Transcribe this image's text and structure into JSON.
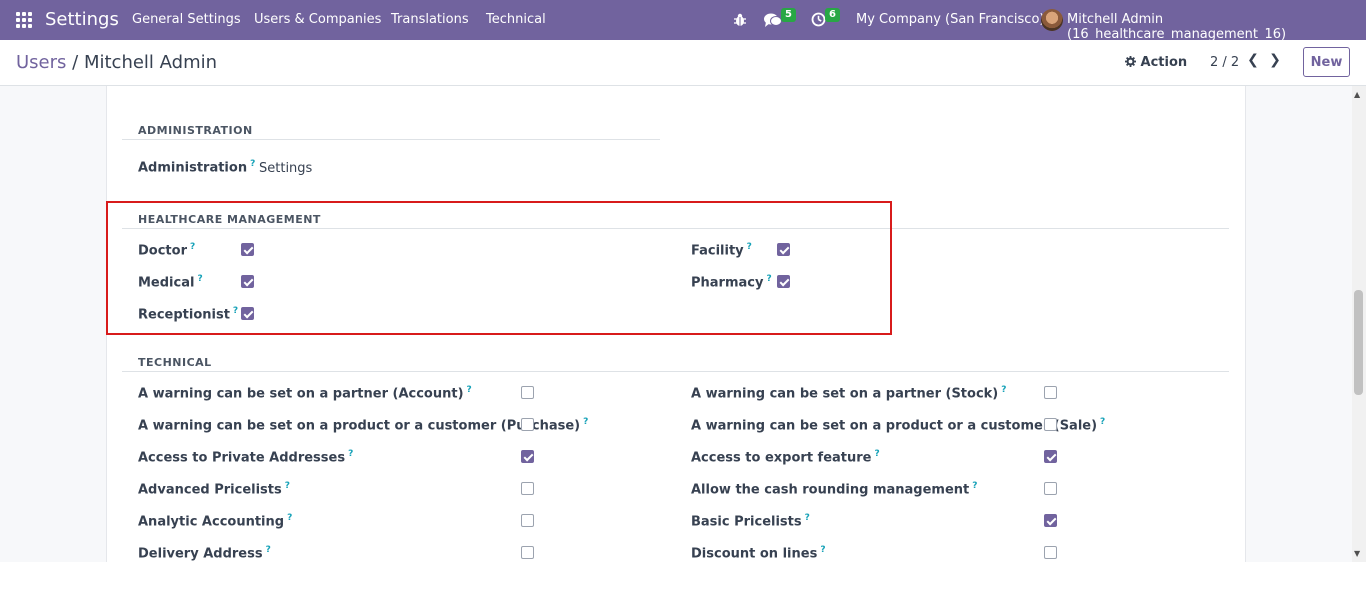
{
  "navbar": {
    "app_title": "Settings",
    "menu": [
      "General Settings",
      "Users & Companies",
      "Translations",
      "Technical"
    ],
    "messages_count": "5",
    "activities_count": "6",
    "company": "My Company (San Francisco)",
    "user": "Mitchell Admin (16_healthcare_management_16)"
  },
  "controlbar": {
    "breadcrumb_parent": "Users",
    "breadcrumb_sep": "/",
    "breadcrumb_current": "Mitchell Admin",
    "action_label": "Action",
    "pager": "2 / 2",
    "new_label": "New"
  },
  "sections": {
    "administration": {
      "title": "ADMINISTRATION",
      "label": "Administration",
      "value": "Settings"
    },
    "healthcare": {
      "title": "HEALTHCARE MANAGEMENT",
      "left": [
        {
          "label": "Doctor",
          "checked": true
        },
        {
          "label": "Medical",
          "checked": true
        },
        {
          "label": "Receptionist",
          "checked": true
        }
      ],
      "right": [
        {
          "label": "Facility",
          "checked": true
        },
        {
          "label": "Pharmacy",
          "checked": true
        }
      ]
    },
    "technical": {
      "title": "TECHNICAL",
      "left": [
        {
          "label": "A warning can be set on a partner (Account)",
          "checked": false
        },
        {
          "label": "A warning can be set on a product or a customer (Purchase)",
          "checked": false
        },
        {
          "label": "Access to Private Addresses",
          "checked": true
        },
        {
          "label": "Advanced Pricelists",
          "checked": false
        },
        {
          "label": "Analytic Accounting",
          "checked": false
        },
        {
          "label": "Delivery Address",
          "checked": false
        }
      ],
      "right": [
        {
          "label": "A warning can be set on a partner (Stock)",
          "checked": false
        },
        {
          "label": "A warning can be set on a product or a customer (Sale)",
          "checked": false
        },
        {
          "label": "Access to export feature",
          "checked": true
        },
        {
          "label": "Allow the cash rounding management",
          "checked": false
        },
        {
          "label": "Basic Pricelists",
          "checked": true
        },
        {
          "label": "Discount on lines",
          "checked": false
        }
      ]
    }
  },
  "help_marker": "?",
  "colors": {
    "brand": "#71639e",
    "badge": "#28a745",
    "highlight_box": "#d81b1b"
  }
}
